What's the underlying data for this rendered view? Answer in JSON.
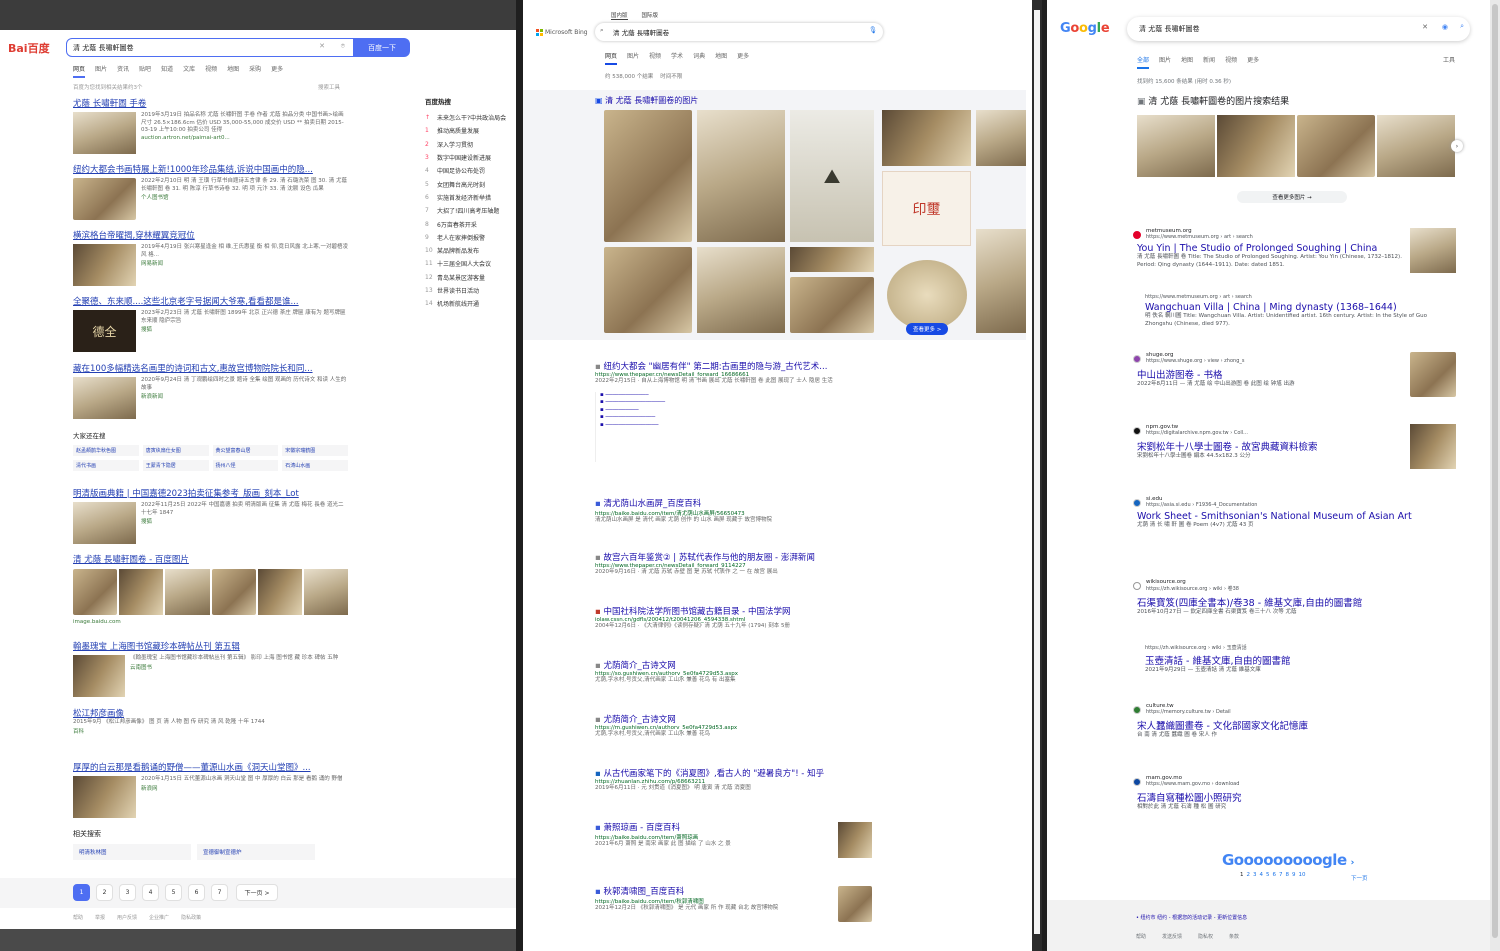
{
  "baidu": {
    "logo": "Bai百度",
    "query": "清 尤蔭 長嘯軒圖卷",
    "search_btn": "百度一下",
    "tabs": [
      "网页",
      "图片",
      "资讯",
      "贴吧",
      "知道",
      "文库",
      "视频",
      "地图",
      "采购",
      "更多"
    ],
    "result_count": "百度为您找到相关结果约3个",
    "tools": "搜索工具",
    "results": [
      {
        "title": "尤蔭 长嘯軒圖 手卷",
        "snip": "2019年3月19日 拍品名称 尤蔭 长嘯軒图 手卷 作者 尤蔭 拍品分类 中国书画>绘画 尺寸 26.5×186.6cm 估价 USD 35,000-55,000 成交价 USD ** 拍卖日期 2015-03-19 上午10:00 拍卖公司 佳得",
        "src": "auction.artron.net/paimai-art0..."
      },
      {
        "title": "纽约大都会书画特展上新!1000年珍品集结,诉说中国画中的隐...",
        "snip": "2022年2月10日 明 清 王璜 行草书自题诗五言律 条 29. 清 石璐洗菜 图 30. 清 尤蔭 长嘯軒图 卷 31. 明 陈淳 行草书诗卷 32. 明 项 元汴 33. 清 沈颢 设色 瓜果",
        "src": "个人图书馆"
      },
      {
        "title": "横滨格台帝曜揭,穿林耀翼竞冠位",
        "snip": "2019年4月19日 张兴寒星逢金 相 维,王氏惠星 衡 相 仰,竟日风露 北上寒,一对碧梧凌风 格...",
        "src": "网易新闻"
      },
      {
        "title": "全聚德、东来顺....这些北京老字号据闻大爷寒,看看都是谁...",
        "snip": "2023年2月23日 清 尤蔭 长嘯軒图 1899年 北京 正兴德 茶庄 牌匾 康有为 题写牌匾 东来顺 隐庐宗旨",
        "src": "搜狐"
      },
      {
        "title": "藏在100多幅精选名画里的诗词和古文,惠故宫博物院院长和同...",
        "snip": "2020年9月24日 清 丁观鹏绘四时之景 题诗 全集 绘图 观画的 历代诗文 和读 人生的故事",
        "src": "新浪新闻"
      },
      {
        "title": "明清版画典籍 | 中国嘉德2023拍卖征集参考_版画_刻本_Lot",
        "snip": "2022年11月25日 2022年 中国嘉德 拍卖 明清版画 征集 清 尤蔭 梅花 長卷 道光二十七年 1847",
        "src": "搜狐"
      },
      {
        "title": "清 尤蔭 長嘯軒圖卷 - 百度图片",
        "src": "image.baidu.com"
      },
      {
        "title": "翰墨瑰宝 上海图书馆藏珍本碑帖丛刊 第五辑",
        "snip": "《翰墨瑰宝 上海图书馆藏珍本碑帖丛刊 第五辑》 影印 上海 图书馆 藏 珍本 碑帖 五种",
        "src": "云南图书"
      },
      {
        "title": "松江邦彦画像",
        "snip": "2015年9月 《松江邦彦画像》 图 页 清 人物 图 传 研究 清 风 乾隆 十年 1744",
        "src": "百科"
      },
      {
        "title": "厚厚的白云那是看鹅诵的野僧——董源山水画《洞天山堂图》...",
        "snip": "2020年1月15日 五代董源山水画 洞天山堂 图 中 厚厚的 白云 那是 看鹅 诵的 野僧",
        "src": "新浪网"
      }
    ],
    "also_title": "大家还在搜",
    "also": [
      "赵孟頫鹊华秋色图",
      "唐寅纨扇仕女图",
      "黄公望富春山居",
      "宋徽宗瑞鹤图",
      "清代书画",
      "王蒙青卞隐居",
      "扬州八怪",
      "石涛山水画"
    ],
    "related_title": "相关搜索",
    "related": [
      "明清秋林图",
      "宣德御制宣德炉"
    ],
    "hot_title": "百度热搜",
    "hot": [
      "未来怎么干?中共政治局会",
      "推动高质量发展",
      "深入学习贯彻",
      "数字中国建设新进展",
      "中国足协公布处罚",
      "女团舞台高光时刻",
      "实施首发经济新举措",
      "大招了!四川高考压轴题",
      "6万亩春茶开采",
      "老人在家摔倒报警",
      "某品牌新品发布",
      "十三届全国人大会议",
      "青岛某景区游客量",
      "世界读书日活动",
      "机场新航线开通"
    ],
    "pages": [
      "1",
      "2",
      "3",
      "4",
      "5",
      "6",
      "7",
      "下一页 >"
    ],
    "footer": [
      "帮助",
      "举报",
      "用户反馈",
      "企业推广",
      "隐私政策"
    ]
  },
  "bing": {
    "top_tabs": [
      "国内版",
      "国际版"
    ],
    "logo": "Microsoft Bing",
    "query": "清 尤蔭 長嘯軒圖卷",
    "tabs": [
      "网页",
      "图片",
      "视频",
      "学术",
      "词典",
      "地图",
      "更多"
    ],
    "count": "约 538,000 个结果",
    "time": "时间不限",
    "img_title": "清 尤蔭 長嘯軒圖卷的图片",
    "more_imgs": "查看更多 >",
    "results": [
      {
        "title": "纽约大都会 \"幽居有伴\" 第二期:古画里的隐与游_古代艺术...",
        "url": "https://www.thepaper.cn/newsDetail_forward_16686661",
        "snip": "2022年2月15日 · 自从上海博物馆 明 清 书画 展出 尤蔭 长嘯軒图 卷 此图 展现了 士人 隐居 生活"
      },
      {
        "title": "清尤荫山水画屏_百度百科",
        "url": "https://baike.baidu.com/item/清尤荫山水画屏/56650473",
        "snip": "清尤荫山水画屏 是 清代 画家 尤荫 创作 的 山水 画屏 现藏于 故宫博物院"
      },
      {
        "title": "故宫六百年鉴赏② | 苏轼代表作与他的朋友圈 - 澎湃新闻",
        "url": "https://www.thepaper.cn/newsDetail_forward_9114227",
        "snip": "2020年9月16日 · 清 尤蔭 苏轼 赤壁 图 是 苏轼 代表作 之 一 在 故宫 展出"
      },
      {
        "title": "中国社科院法学所图书馆藏古籍目录 - 中国法学网",
        "url": "iolaw.cssn.cn/gdfls/200412/t20041206_4594338.shtml",
        "snip": "2004年12月6日 · 《大清律例》《读例存疑》清 尤荫 五十九年 (1794) 刻本 5册"
      },
      {
        "title": "尤荫简介_古诗文网",
        "url": "https://so.gushiwen.cn/authorv_5e0fa4729d53.aspx",
        "snip": "尤荫,字水村,号贡父,清代画家 工山水 兼善 花鸟 有 出塞集"
      },
      {
        "title": "尤荫简介_古诗文网",
        "url": "https://m.gushiwen.cn/authorv_5e0fa4729d53.aspx",
        "snip": "尤荫,字水村,号贡父,清代画家 工山水 兼善 花鸟"
      },
      {
        "title": "从古代画家笔下的《消夏图》,看古人的 \"避暑良方\"! - 知乎",
        "url": "https://zhuanlan.zhihu.com/p/68663211",
        "snip": "2019年6月11日 · 元 刘贯道《消夏图》 明 唐寅 清 尤蔭 消夏图"
      },
      {
        "title": "萧照琼画 - 百度百科",
        "url": "https://baike.baidu.com/item/萧照琼画",
        "snip": "2021年6月 萧照 是 南宋 画家 此 图 描绘 了 山水 之 景"
      },
      {
        "title": "秋郭清啸图_百度百科",
        "url": "https://baike.baidu.com/item/秋郭清啸图",
        "snip": "2021年12月2日 《秋郭清啸图》 是 元代 画家 所 作 现藏 台北 故宫博物院"
      }
    ]
  },
  "google": {
    "logo": "Google",
    "query": "清 尤蔭 長嘯軒圖卷",
    "tabs": [
      "全部",
      "图片",
      "地图",
      "新闻",
      "视频",
      "更多"
    ],
    "tools": "工具",
    "count": "找到约 15,600 条结果 (用时 0.36 秒)",
    "img_title": "清 尤蔭 長嘯軒圖卷的图片搜索结果",
    "see_more": "查看更多图片 →",
    "results": [
      {
        "site": "metmuseum.org",
        "url": "https://www.metmuseum.org › art › search",
        "title": "You Yin | The Studio of Prolonged Soughing | China",
        "snip": "清 尤蔭 長嘯軒圖 卷 Title: The Studio of Prolonged Soughing. Artist: You Yin (Chinese, 1732–1812). Period: Qing dynasty (1644–1911). Date: dated 1851."
      },
      {
        "site": "",
        "url": "https://www.metmuseum.org › art › search",
        "title": "Wangchuan Villa | China | Ming dynasty (1368–1644)",
        "snip": "明 佚名 輞川圖 Title: Wangchuan Villa. Artist: Unidentified artist. 16th century. Artist: In the Style of Guo Zhongshu (Chinese, died 977)."
      },
      {
        "site": "shuge.org",
        "url": "https://www.shuge.org › view › zhong_s",
        "title": "中山出游图卷 - 书格",
        "snip": "2022年8月11日 — 清 尤蔭 绘 中山出游图 卷 此图 绘 钟馗 出游"
      },
      {
        "site": "npm.gov.tw",
        "url": "https://digitalarchive.npm.gov.tw › Coll...",
        "title": "宋劉松年十八學士圖卷 - 故宮典藏資料檢索",
        "snip": "宋劉松年十八學士圖卷 絹本 44.5x182.3 公分"
      },
      {
        "site": "si.edu",
        "url": "https://asia.si.edu › F1936-4_Documentation",
        "title": "Work Sheet - Smithsonian's National Museum of Asian Art",
        "snip": "尤荫 清 长 嘯 軒 圖 卷 Poem (4v7) 尤蔭 43 页"
      },
      {
        "site": "wikisource.org",
        "url": "https://zh.wikisource.org › wiki › 卷38",
        "title": "石渠寶笈(四庫全書本)/卷38 - 維基文庫,自由的圖書館",
        "snip": "2016年10月27日 — 欽定四庫全書 石渠寶笈 卷三十八 次等 尤蔭"
      },
      {
        "site": "",
        "url": "https://zh.wikisource.org › wiki › 玉壺清話",
        "title": "玉壺清話 - 維基文庫,自由的圖書館",
        "snip": "2021年9月29日 — 玉壺清話 清 尤蔭 維基文庫"
      },
      {
        "site": "culture.tw",
        "url": "https://memory.culture.tw › Detail",
        "title": "宋人蠶織圖畫卷 - 文化部國家文化記憶庫",
        "snip": "台 南 清 尤蔭 蠶織 圖 卷 宋人 作"
      },
      {
        "site": "mam.gov.mo",
        "url": "https://www.mam.gov.mo › download",
        "title": "石濤自寫種松圖小照研究",
        "snip": "相對於此 清 尤蔭 石濤 種 松 圖 研究"
      }
    ],
    "pager_logo": "Gooooooooogle",
    "pages": [
      "1",
      "2",
      "3",
      "4",
      "5",
      "6",
      "7",
      "8",
      "9",
      "10"
    ],
    "next": "下一页",
    "footer_loc": "• 纽约市 纽约 - 根据您的活动记录 - 更新位置信息",
    "footer": [
      "帮助",
      "发送反馈",
      "隐私权",
      "条款"
    ]
  }
}
